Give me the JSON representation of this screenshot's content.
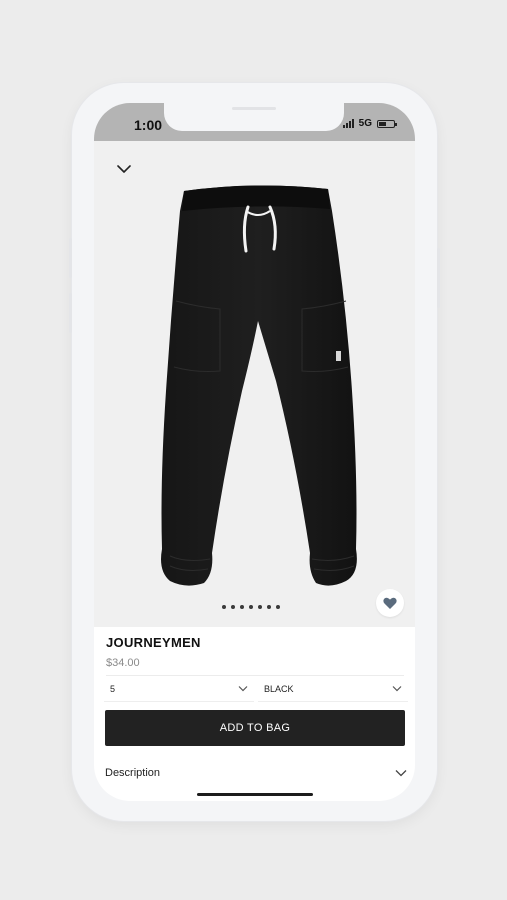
{
  "status_bar": {
    "time": "1:00",
    "network": "5G"
  },
  "product": {
    "name": "JOURNEYMEN",
    "price": "$34.00",
    "image_icon": "black-sweatpants-image",
    "gallery_dots": 7
  },
  "options": {
    "size_value": "5",
    "color_value": "BLACK"
  },
  "actions": {
    "add_to_bag_label": "ADD TO BAG",
    "description_label": "Description"
  },
  "colors": {
    "button_bg": "#222222",
    "favorite_heart": "#5a6b7d",
    "status_bar_bg": "#b4b4b4"
  }
}
